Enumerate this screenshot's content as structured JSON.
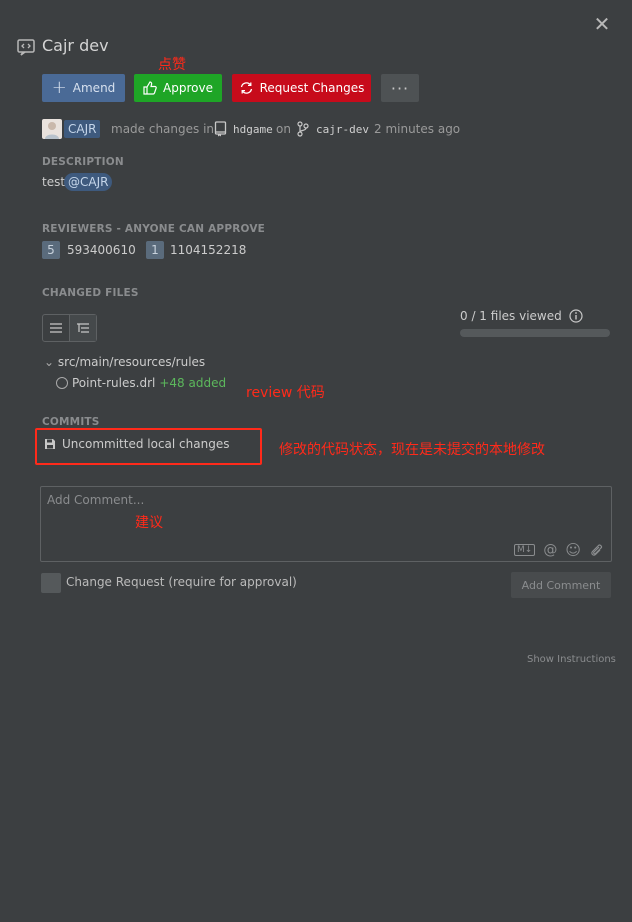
{
  "header": {
    "title": "Cajr dev",
    "close_glyph": "✕"
  },
  "actions": {
    "amend_label": "Amend",
    "approve_label": "Approve",
    "request_changes_label": "Request Changes",
    "more_label": "···"
  },
  "annotations": {
    "approve_note": "点赞",
    "review_note": "review 代码",
    "commit_note": "修改的代码状态，现在是未提交的本地修改",
    "comment_note": "建议"
  },
  "meta": {
    "user": "CAJR",
    "made_changes_in": "made changes in",
    "repo": "hdgame",
    "on": "on",
    "branch": "cajr-dev",
    "time": "2 minutes ago"
  },
  "description": {
    "header": "DESCRIPTION",
    "text": "test",
    "mention": "@CAJR"
  },
  "reviewers": {
    "header": "REVIEWERS - ANYONE CAN APPROVE",
    "items": [
      {
        "badge": "5",
        "name": "593400610"
      },
      {
        "badge": "1",
        "name": "1104152218"
      }
    ]
  },
  "changed_files": {
    "header": "CHANGED FILES",
    "files_viewed": "0 / 1 files viewed",
    "progress_fraction": 0,
    "folder": "src/main/resources/rules",
    "file_name": "Point-rules.drl",
    "file_added": "+48 added"
  },
  "commits": {
    "header": "COMMITS",
    "item": "Uncommitted local changes"
  },
  "comment": {
    "placeholder": "Add Comment...",
    "change_request_label": "Change Request (require for approval)",
    "add_comment_label": "Add Comment",
    "tools": [
      "M↓",
      "@",
      "☺",
      "📎"
    ]
  },
  "footer": {
    "show_instructions": "Show Instructions"
  },
  "colors": {
    "background": "#3c3f41",
    "approve": "#1ea526",
    "request_changes": "#c70b1b",
    "amend": "#4a6a96",
    "annotation": "#ff2a1a"
  }
}
